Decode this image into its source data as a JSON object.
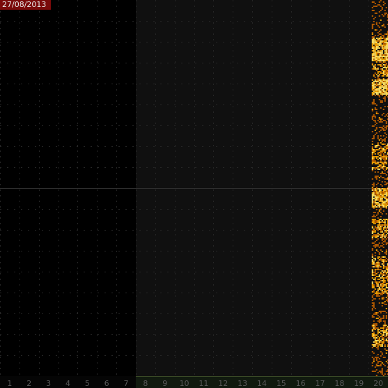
{
  "date": "27/08/2013",
  "colors": {
    "background": "#000000",
    "shaded_region": "#101010",
    "grid": "#262626",
    "axis_band_fill": "#111a0f",
    "axis_band_border": "#3a4a26",
    "tick_text": "#5a5a5a",
    "date_badge": "#7a0a0a",
    "signal_low": "#b35a00",
    "signal_mid": "#f0a000",
    "signal_high": "#ffe060"
  },
  "chart_data": {
    "type": "heatmap",
    "title": "",
    "xlabel": "",
    "ylabel": "",
    "x_ticks": [
      "1",
      "2",
      "3",
      "4",
      "5",
      "6",
      "7",
      "8",
      "9",
      "10",
      "11",
      "12",
      "13",
      "14",
      "15",
      "16",
      "17",
      "18",
      "19",
      "20"
    ],
    "xlim": [
      0.5,
      20.5
    ],
    "grid": true,
    "dark_hours": [
      0,
      7
    ],
    "data_starts_at_hour": 20.2,
    "activity_bands": [
      {
        "level": "high",
        "rows": [
          0.1,
          0.16
        ]
      },
      {
        "level": "mid",
        "rows": [
          0.17,
          0.2
        ]
      },
      {
        "level": "high",
        "rows": [
          0.21,
          0.25
        ]
      },
      {
        "level": "mid",
        "rows": [
          0.38,
          0.45
        ]
      },
      {
        "level": "high",
        "rows": [
          0.5,
          0.55
        ]
      },
      {
        "level": "mid",
        "rows": [
          0.58,
          0.63
        ]
      },
      {
        "level": "mid",
        "rows": [
          0.68,
          0.78
        ]
      },
      {
        "level": "mid",
        "rows": [
          0.86,
          0.92
        ]
      }
    ]
  }
}
